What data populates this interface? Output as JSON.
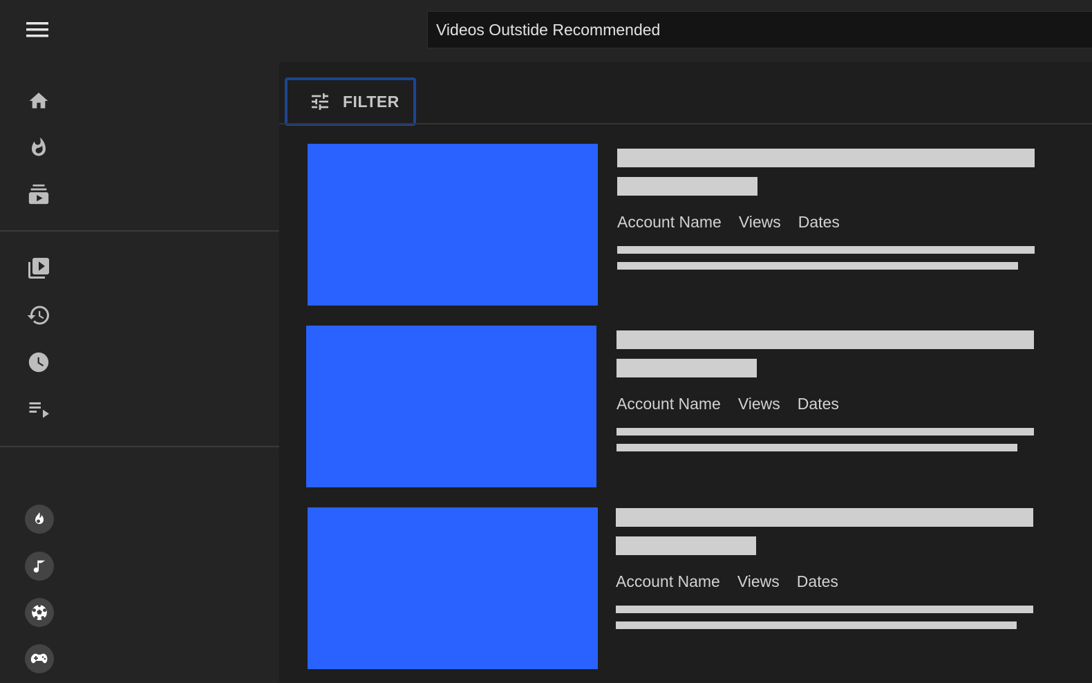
{
  "header": {
    "search_value": "Videos Outstide Recommended"
  },
  "sidebar": {
    "primary": [
      "home-icon",
      "trending-icon",
      "subscriptions-icon"
    ],
    "library": [
      "library-icon",
      "history-icon",
      "watch-later-icon",
      "playlist-icon"
    ],
    "categories": [
      "gaming-icon",
      "music-icon",
      "sports-icon",
      "game-controller-icon"
    ]
  },
  "toolbar": {
    "filter_label": "FILTER",
    "accent_color": "#1c4591"
  },
  "videos": [
    {
      "account": "Account Name",
      "views": "Views",
      "dates": "Dates"
    },
    {
      "account": "Account Name",
      "views": "Views",
      "dates": "Dates"
    },
    {
      "account": "Account Name",
      "views": "Views",
      "dates": "Dates"
    }
  ],
  "colors": {
    "background": "#242424",
    "thumbnail": "#2962ff",
    "placeholder": "#cfcfcf"
  }
}
